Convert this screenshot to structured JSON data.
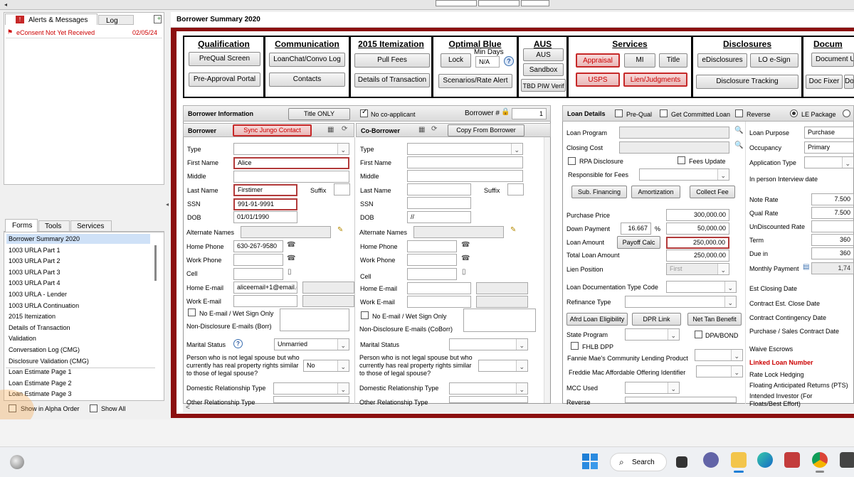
{
  "alerts": {
    "tab_alerts": "Alerts & Messages",
    "tab_log": "Log",
    "item_text": "eConsent Not Yet Received",
    "item_date": "02/05/24"
  },
  "sidebar": {
    "tabs": [
      "Forms",
      "Tools",
      "Services"
    ],
    "items": [
      "Borrower Summary 2020",
      "1003 URLA Part 1",
      "1003 URLA Part 2",
      "1003 URLA Part 3",
      "1003 URLA Part 4",
      "1003 URLA - Lender",
      "1003 URLA Continuation",
      "2015 Itemization",
      "Details of Transaction",
      "Validation",
      "Conversation Log (CMG)",
      "Disclosure Validation (CMG)",
      "Loan Estimate Page 1",
      "Loan Estimate Page 2",
      "Loan Estimate Page 3"
    ],
    "show_alpha": "Show in Alpha Order",
    "show_all": "Show All"
  },
  "form_title": "Borrower Summary 2020",
  "top": {
    "qualification": {
      "title": "Qualification",
      "btn1": "PreQual Screen",
      "btn2": "Pre-Approval Portal"
    },
    "communication": {
      "title": "Communication",
      "btn1": "LoanChat/Convo Log",
      "btn2": "Contacts"
    },
    "itemization": {
      "title": "2015 Itemization",
      "btn1": "Pull Fees",
      "btn2": "Details of Transaction"
    },
    "optimal": {
      "title": "Optimal Blue",
      "lock": "Lock",
      "min_days_label": "Min Days",
      "min_days_value": "N/A",
      "help": "?",
      "scenarios": "Scenarios/Rate Alert"
    },
    "aus": {
      "title": "AUS",
      "btn1": "AUS",
      "btn2": "Sandbox",
      "btn3": "TBD PIW Verif"
    },
    "services": {
      "title": "Services",
      "appraisal": "Appraisal",
      "mi": "MI",
      "title_btn": "Title",
      "usps": "USPS",
      "lien": "Lien/Judgments"
    },
    "disclosures": {
      "title": "Disclosures",
      "edisc": "eDisclosures",
      "lo_esign": "LO e-Sign",
      "tracking": "Disclosure Tracking"
    },
    "documents": {
      "title": "Docum",
      "doc_btn": "Document U",
      "doc_fixer": "Doc Fixer",
      "do": "Do"
    }
  },
  "borrower_info": {
    "title": "Borrower Information",
    "title_only": "Title ONLY",
    "no_coapp": "No co-applicant",
    "borrower_num_label": "Borrower #",
    "borrower_num": "1"
  },
  "borrower": {
    "header": "Borrower",
    "sync": "Sync Jungo Contact",
    "type": "Type",
    "first_name": "First Name",
    "first_name_val": "Alice",
    "middle": "Middle",
    "last_name": "Last Name",
    "last_name_val": "Firstimer",
    "suffix": "Suffix",
    "ssn": "SSN",
    "ssn_val": "991-91-9991",
    "dob": "DOB",
    "dob_val": "01/01/1990",
    "alt_names": "Alternate Names",
    "home_phone": "Home Phone",
    "home_phone_val": "630-267-9580",
    "work_phone": "Work Phone",
    "cell": "Cell",
    "home_email": "Home E-mail",
    "home_email_val": "aliceemail+1@email.c",
    "work_email": "Work E-mail",
    "no_email": "No E-mail / Wet Sign Only",
    "non_disc": "Non-Disclosure E-mails (Borr)",
    "marital": "Marital Status",
    "marital_val": "Unmarried",
    "person_not": "Person who is not legal spouse but who currently has real property rights similar to those of legal spouse?",
    "person_val": "No",
    "domestic": "Domestic Relationship Type",
    "other_rel": "Other Relationship Type"
  },
  "coborrower": {
    "header": "Co-Borrower",
    "copy": "Copy From Borrower",
    "type": "Type",
    "first_name": "First Name",
    "middle": "Middle",
    "last_name": "Last Name",
    "suffix": "Suffix",
    "ssn": "SSN",
    "dob": "DOB",
    "dob_val": "//",
    "alt_names": "Alternate Names",
    "home_phone": "Home Phone",
    "work_phone": "Work Phone",
    "cell": "Cell",
    "home_email": "Home E-mail",
    "work_email": "Work E-mail",
    "no_email": "No E-mail / Wet Sign Only",
    "non_disc": "Non-Disclosure E-mails (CoBorr)",
    "marital": "Marital Status",
    "person_not": "Person who is not legal spouse but who currently has real property rights similar to those of legal spouse?",
    "domestic": "Domestic Relationship Type",
    "other_rel": "Other Relationship Type"
  },
  "loan": {
    "title": "Loan Details",
    "prequal": "Pre-Qual",
    "committed": "Get Committed Loan",
    "reverse": "Reverse",
    "le_package": "LE Package",
    "loan_program": "Loan Program",
    "closing_cost": "Closing Cost",
    "rpa": "RPA Disclosure",
    "fees_update": "Fees Update",
    "responsible": "Responsible for Fees",
    "sub_fin": "Sub. Financing",
    "amort": "Amortization",
    "collect": "Collect Fee",
    "purchase_price": "Purchase Price",
    "purchase_price_val": "300,000.00",
    "down_payment": "Down Payment",
    "down_pct": "16.667",
    "pct": "%",
    "down_val": "50,000.00",
    "loan_amount": "Loan Amount",
    "payoff": "Payoff Calc",
    "loan_amount_val": "250,000.00",
    "total_loan": "Total Loan Amount",
    "total_loan_val": "250,000.00",
    "lien_position": "Lien Position",
    "lien_val": "First",
    "doc_type": "Loan Documentation Type Code",
    "refi_type": "Refinance Type",
    "afrd": "Afrd Loan Eligibility",
    "dpr": "DPR Link",
    "net_tan": "Net Tan Benefit",
    "state_program": "State Program",
    "dpa": "DPA/BOND",
    "fhlb": "FHLB DPP",
    "fannie": "Fannie Mae's Community Lending Product",
    "freddie": "Freddie Mac Affordable Offering Identifier",
    "mcc": "MCC Used",
    "reverse2": "Reverse"
  },
  "loan_right": {
    "purpose": "Loan Purpose",
    "purpose_val": "Purchase",
    "occupancy": "Occupancy",
    "occupancy_val": "Primary",
    "app_type": "Application Type",
    "in_person": "In person Interview date",
    "note_rate": "Note Rate",
    "note_rate_val": "7.500",
    "qual_rate": "Qual Rate",
    "qual_rate_val": "7.500",
    "undisc": "UnDiscounted Rate",
    "term": "Term",
    "term_val": "360",
    "due_in": "Due in",
    "due_in_val": "360",
    "monthly": "Monthly Payment",
    "monthly_val": "1,74",
    "est_closing": "Est Closing Date",
    "contract_close": "Contract Est. Close  Date",
    "contract_cont": "Contract Contingency Date",
    "purchase_sales": "Purchase / Sales Contract Date",
    "waive": "Waive Escrows",
    "linked": "Linked Loan Number",
    "rate_lock": "Rate Lock Hedging",
    "floating": "Floating Anticipated Returns (PTS)",
    "intended": "Intended Investor (For Floats/Best Effort)"
  },
  "taskbar": {
    "search": "Search"
  }
}
